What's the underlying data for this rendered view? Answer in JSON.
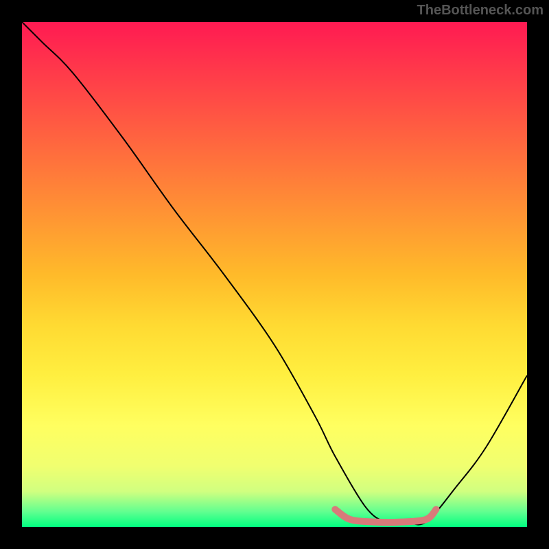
{
  "watermark": "TheBottleneck.com",
  "chart_data": {
    "type": "line",
    "title": "",
    "xlabel": "",
    "ylabel": "",
    "xlim": [
      0,
      100
    ],
    "ylim": [
      0,
      100
    ],
    "series": [
      {
        "name": "bottleneck-curve",
        "color": "#000000",
        "x": [
          0,
          4,
          10,
          20,
          30,
          40,
          50,
          58,
          62,
          68,
          72,
          76,
          80,
          86,
          92,
          100
        ],
        "y": [
          100,
          96,
          90,
          77,
          63,
          50,
          36,
          22,
          14,
          4,
          1,
          1,
          1,
          8,
          16,
          30
        ]
      },
      {
        "name": "optimal-highlight",
        "color": "#d87a7a",
        "x": [
          62,
          65,
          70,
          75,
          80,
          82
        ],
        "y": [
          3.5,
          1.5,
          1,
          1,
          1.5,
          3.5
        ]
      }
    ],
    "gradient_stops": [
      {
        "pos": 0,
        "color": "#ff1a52"
      },
      {
        "pos": 50,
        "color": "#ffba2a"
      },
      {
        "pos": 80,
        "color": "#ffff60"
      },
      {
        "pos": 100,
        "color": "#00ff80"
      }
    ]
  }
}
